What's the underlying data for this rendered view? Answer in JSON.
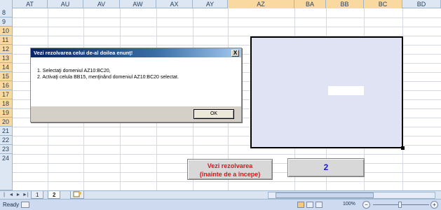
{
  "spreadsheet": {
    "columns": [
      "AT",
      "AU",
      "AV",
      "AW",
      "AX",
      "AY",
      "AZ",
      "BA",
      "BB",
      "BC",
      "BD"
    ],
    "rows": [
      "8",
      "9",
      "10",
      "11",
      "12",
      "13",
      "14",
      "15",
      "16",
      "17",
      "18",
      "19",
      "20",
      "21",
      "22",
      "23",
      "24"
    ]
  },
  "dialog": {
    "title": "Vezi rezolvarea celui de-al doilea enunţ!",
    "close_label": "X",
    "line1": "1. Selectaţi domeniul AZ10:BC20,",
    "line2": "2. Activaţi celula BB15, menţinând domeniul AZ10:BC20 selectat.",
    "ok_label": "OK"
  },
  "buttons": {
    "solution_line1": "Vezi rezolvarea",
    "solution_line2": "(înainte de a începe)",
    "number_label": "2"
  },
  "sheet_tabs": {
    "nav": [
      "|◄",
      "◄",
      "►",
      "►|"
    ],
    "tab1": "1",
    "tab2": "2",
    "new_sheet_icon": "new-sheet-icon"
  },
  "status_bar": {
    "status": "Ready",
    "zoom": "100%"
  },
  "colors": {
    "selection_fill": "#dfe3f3",
    "selected_header": "#f9d99f",
    "button_red_text": "#e0141c",
    "button_blue_text": "#1a1ad0",
    "title_bar": "#0a246a"
  }
}
